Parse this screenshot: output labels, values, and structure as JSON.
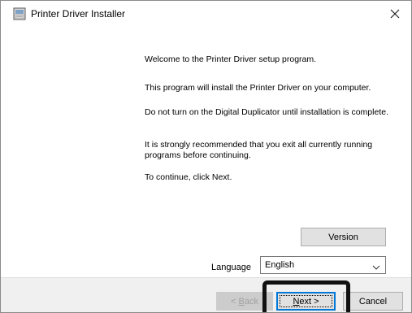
{
  "window": {
    "title": "Printer Driver Installer",
    "close_label": "×"
  },
  "body": {
    "paragraphs": [
      "Welcome to the Printer Driver setup program.",
      "This program will install the Printer Driver on your computer.",
      "Do not turn on the Digital Duplicator until installation is complete.",
      "It is strongly recommended that you exit all currently running programs before continuing.",
      "To continue, click Next."
    ]
  },
  "controls": {
    "version_label": "Version",
    "language_label": "Language",
    "language_selected": "English"
  },
  "footer": {
    "back_accel": "B",
    "back_rest": "ack",
    "back_prefix": "< ",
    "next_accel": "N",
    "next_rest": "ext >",
    "cancel_label": "Cancel"
  },
  "colors": {
    "accent": "#0078d7",
    "footer_bg": "#f0f0f0",
    "button_bg": "#e1e1e1",
    "highlight_box": "#111111"
  },
  "icons": {
    "app": "installer-icon",
    "close": "close-icon",
    "dropdown": "chevron-down-icon"
  }
}
